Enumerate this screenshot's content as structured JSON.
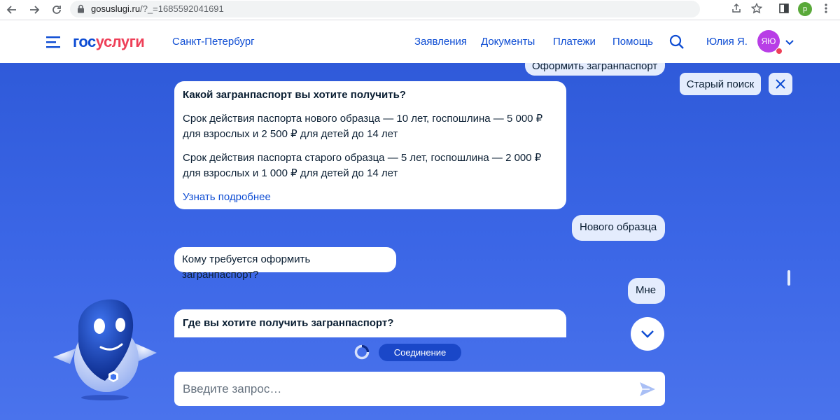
{
  "browser": {
    "url_host": "gosuslugi.ru",
    "url_path": "/?_=1685592041691",
    "profile_letter": "p"
  },
  "header": {
    "logo_part1": "гос",
    "logo_part2": "услуги",
    "city": "Санкт-Петербург",
    "nav": [
      "Заявления",
      "Документы",
      "Платежи",
      "Помощь"
    ],
    "user_name": "Юлия Я.",
    "avatar_initials": "ЯЮ"
  },
  "chat": {
    "top_cut_message": "Оформить загранпаспорт",
    "old_search_label": "Старый поиск",
    "messages": [
      {
        "from": "bot",
        "title": "Какой загранпаспорт вы хотите получить?",
        "para1": "Срок действия паспорта нового образца — 10 лет, госпошлина — 5 000 ₽ для взрослых и 2 500 ₽ для детей до 14 лет",
        "para2": "Срок действия паспорта старого образца — 5 лет, госпошлина — 2 000 ₽ для взрослых и 1 000 ₽ для детей до 14 лет",
        "link": "Узнать подробнее"
      },
      {
        "from": "user",
        "text": "Нового образца"
      },
      {
        "from": "bot",
        "text": "Кому требуется оформить загранпаспорт?"
      },
      {
        "from": "user",
        "text": "Мне"
      },
      {
        "from": "bot",
        "title": "Где вы хотите получить загранпаспорт?"
      }
    ],
    "status_label": "Соединение",
    "input_placeholder": "Введите запрос…"
  },
  "colors": {
    "brand_blue": "#0d4cd3",
    "brand_red": "#ee3f58",
    "bg_blue": "#3b66e6",
    "user_bubble": "#e4ecfd"
  }
}
